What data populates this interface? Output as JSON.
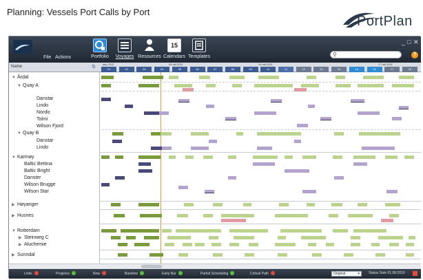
{
  "slide": {
    "title": "Planning: Vessels Port Calls by Port",
    "logo_text": "PortPlan"
  },
  "menu": {
    "file": "File",
    "actions": "Actions"
  },
  "ribbon": [
    {
      "label": "Portfolio",
      "icon": "portfolio-icon"
    },
    {
      "label": "Voyages",
      "icon": "voyages-icon"
    },
    {
      "label": "Resources",
      "icon": "resources-icon"
    },
    {
      "label": "Calendars",
      "icon": "calendars-icon",
      "glyph": "15"
    },
    {
      "label": "Templates",
      "icon": "templates-icon"
    }
  ],
  "window_controls": {
    "minimize": "_",
    "maximize": "□",
    "close": "✕"
  },
  "header": {
    "name": "Name",
    "weeks": [
      "sep 2011",
      "03 okt 2011",
      "10 okt 2011",
      "17 okt 2011"
    ],
    "days": [
      "01",
      "02",
      "03",
      "04",
      "05",
      "06",
      "07",
      "08",
      "09",
      "10",
      "11",
      "12",
      "13",
      "14",
      "15",
      "16",
      "17",
      "18"
    ],
    "day_colors": [
      "#3a5c92",
      "#3a5c92",
      "#3a5c92",
      "#3a5c92",
      "#3a5c92",
      "#3a5c92",
      "#3a5c92",
      "#3a5c92",
      "#3a5c92",
      "#3a5c92",
      "#4a6faa",
      "#6b7a90",
      "#6b7a90",
      "#6b7a90",
      "#2f8ad6",
      "#2f8ad6",
      "#6b7a90",
      "#6b7a90"
    ]
  },
  "tree": {
    "ardal": "Årdal",
    "quay_a": "Quay A",
    "quay_a_vessels": [
      "Danstar",
      "Lindo",
      "Nordic",
      "Tolmi",
      "Wilson Fjord"
    ],
    "quay_b": "Quay B",
    "quay_b_vessels": [
      "Danstar",
      "Lindo"
    ],
    "karmoy": "Karmøy",
    "karmoy_vessels": [
      "Baltic Bettina",
      "Baltic Bright",
      "Danster",
      "Wilson Brugge",
      "Wilson Star"
    ],
    "hoyanger": "Høyanger",
    "husnes": "Husnes",
    "rotterdam": "Rotterdam",
    "rotterdam_children": [
      "Steinweg C",
      "Aluchemie"
    ],
    "sunndal": "Sunndal"
  },
  "legend": {
    "items": [
      {
        "label": "Links",
        "color": "#e24b3a"
      },
      {
        "label": "Progress",
        "color": "#5bbf3a"
      },
      {
        "label": "Now",
        "color": "#e24b3a"
      },
      {
        "label": "Baseline",
        "color": "#5bbf3a"
      },
      {
        "label": "Early Bar",
        "color": "#5bbf3a"
      },
      {
        "label": "Partial Scheduling",
        "color": "#5bbf3a"
      },
      {
        "label": "Critical Path",
        "color": "#e24b3a"
      }
    ],
    "view_select": "Original",
    "status_date": "Status Date  01.08.2010"
  },
  "colors": {
    "summary_bar": "#7a9b3c",
    "planned_bar": "#bcd38d",
    "vessel_bar_dark": "#4a4a78",
    "vessel_bar_light": "#b4a3cf",
    "conflict_bar": "#e29aa1",
    "today_line": "#d29a3a"
  }
}
